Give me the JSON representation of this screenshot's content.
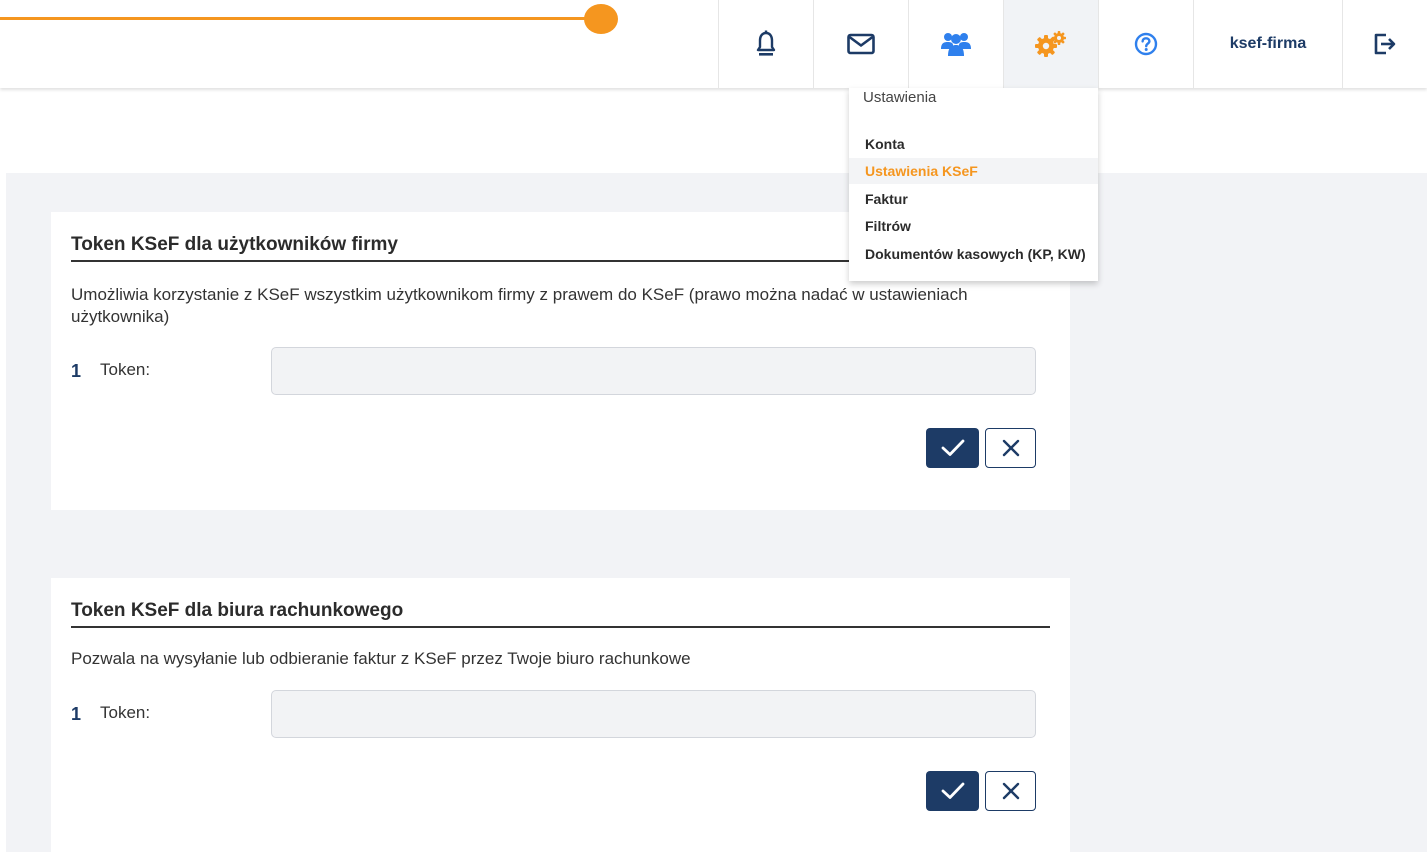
{
  "colors": {
    "accent": "#f5961f",
    "primary": "#1d3b66",
    "background": "#f2f3f6"
  },
  "header": {
    "icons": [
      "bell-icon",
      "mail-icon",
      "users-icon",
      "settings-icon",
      "help-icon",
      "logout-icon"
    ],
    "user_name": "ksef-firma"
  },
  "menu": {
    "title": "Ustawienia",
    "items": [
      {
        "label": "Konta"
      },
      {
        "label": "Ustawienia KSeF",
        "active": true
      },
      {
        "label": "Faktur"
      },
      {
        "label": "Filtrów"
      },
      {
        "label": "Dokumentów kasowych (KP, KW)"
      }
    ]
  },
  "sections": [
    {
      "title": "Token KSeF dla użytkowników firmy",
      "description": "Umożliwia korzystanie z KSeF wszystkim użytkownikom firmy z prawem do KSeF (prawo można nadać w ustawieniach użytkownika)",
      "row_number": "1",
      "token_label": "Token:",
      "token_value": ""
    },
    {
      "title": "Token KSeF dla biura rachunkowego",
      "description": "Pozwala na wysyłanie lub odbieranie faktur z KSeF przez Twoje biuro rachunkowe",
      "row_number": "1",
      "token_label": "Token:",
      "token_value": ""
    }
  ]
}
